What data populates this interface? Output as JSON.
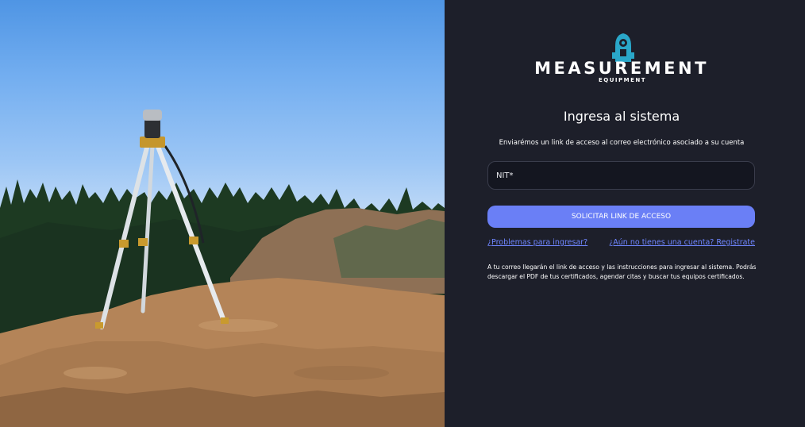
{
  "brand": {
    "name": "MEASUREMENT",
    "tagline": "EQUIPMENT",
    "accent_color": "#2aa7c9"
  },
  "login": {
    "title": "Ingresa al sistema",
    "subtitle": "Enviarémos un link de acceso al correo electrónico asociado a su cuenta",
    "nit_placeholder": "NIT*",
    "nit_value": "",
    "submit_label": "SOLICITAR LINK DE ACCESO",
    "problems_link": "¿Problemas para ingresar?",
    "register_link": "¿Aún no tienes una cuenta? Registrate",
    "info_text": "A tu correo llegarán el link de acceso y las instrucciones para ingresar al sistema. Podrás descargar el PDF de tus certificados, agendar citas y buscar tus equipos certificados."
  },
  "colors": {
    "panel_bg": "#1d1f2a",
    "input_bg": "#141620",
    "button_bg": "#6a7ff6",
    "link": "#6f86ff"
  },
  "photo": {
    "subject": "surveying tripod on sand with forest and blue sky"
  }
}
